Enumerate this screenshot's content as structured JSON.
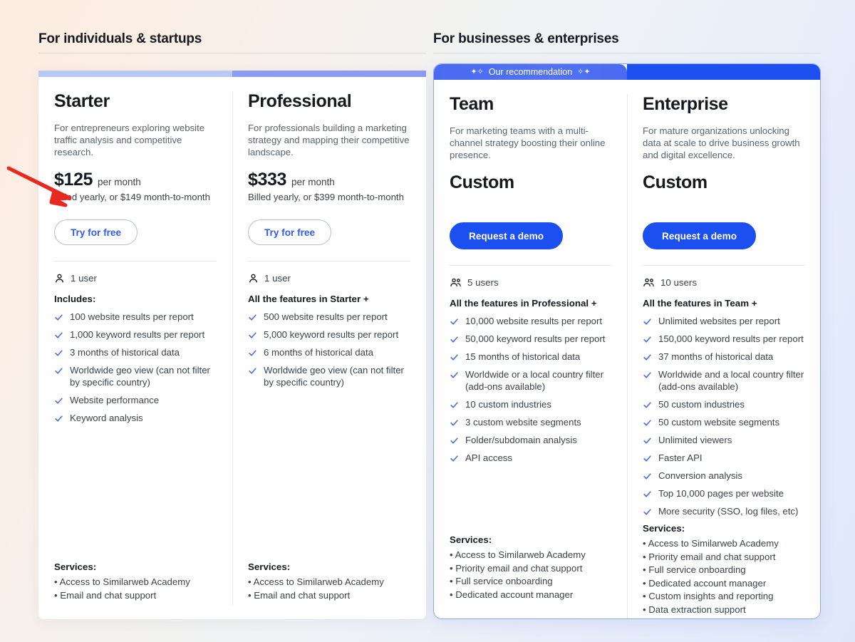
{
  "groups": [
    {
      "heading": "For individuals & startups",
      "recommended_ribbon": null,
      "plans": [
        {
          "name": "Starter",
          "description": "For entrepreneurs exploring website traffic analysis and competitive research.",
          "price": "$125",
          "price_unit": "per month",
          "billed_note": "Billed yearly, or $149 month-to-month",
          "cta_label": "Try for free",
          "cta_style": "outline",
          "users_icon": "single-user-icon",
          "users_label": "1 user",
          "features_title": "Includes:",
          "features": [
            "100 website results per report",
            "1,000 keyword results per report",
            "3 months of historical data",
            "Worldwide geo view (can not filter by specific country)",
            "Website performance",
            "Keyword analysis"
          ],
          "services_title": "Services:",
          "services": [
            "Access to Similarweb Academy",
            "Email and chat support"
          ],
          "strip_color": "#b9c9f6"
        },
        {
          "name": "Professional",
          "description": "For professionals building a marketing strategy and mapping their competitive landscape.",
          "price": "$333",
          "price_unit": "per month",
          "billed_note": "Billed yearly, or $399 month-to-month",
          "cta_label": "Try for free",
          "cta_style": "outline",
          "users_icon": "single-user-icon",
          "users_label": "1 user",
          "features_title": "All the features in Starter +",
          "features": [
            "500 website results per report",
            "5,000 keyword results per report",
            "6 months of historical data",
            "Worldwide geo view (can not filter by specific country)"
          ],
          "services_title": "Services:",
          "services": [
            "Access to Similarweb Academy",
            "Email and chat support"
          ],
          "strip_color": "#8c9cf2"
        }
      ]
    },
    {
      "heading": "For businesses & enterprises",
      "recommended_ribbon": "Our recommendation",
      "plans": [
        {
          "name": "Team",
          "description": "For marketing teams with a multi-channel strategy boosting their online presence.",
          "price": "Custom",
          "price_unit": "",
          "billed_note": "",
          "cta_label": "Request a demo",
          "cta_style": "solid",
          "users_icon": "multi-user-icon",
          "users_label": "5 users",
          "features_title": "All the features in Professional +",
          "features": [
            "10,000 website results per report",
            "50,000 keyword results per report",
            "15 months of historical data",
            "Worldwide or a local country filter (add-ons available)",
            "10 custom industries",
            "3 custom website segments",
            "Folder/subdomain analysis",
            "API access"
          ],
          "services_title": "Services:",
          "services": [
            "Access to Similarweb Academy",
            "Priority email and chat support",
            "Full service onboarding",
            "Dedicated account manager"
          ],
          "strip_color": "#4a6bf0"
        },
        {
          "name": "Enterprise",
          "description": "For mature organizations unlocking data at scale to drive business growth and digital excellence.",
          "price": "Custom",
          "price_unit": "",
          "billed_note": "",
          "cta_label": "Request a demo",
          "cta_style": "solid",
          "users_icon": "multi-user-icon",
          "users_label": "10 users",
          "features_title": "All the features in Team +",
          "features": [
            "Unlimited websites per report",
            "150,000 keyword results per report",
            "37 months of historical data",
            "Worldwide and a local country filter (add-ons available)",
            "50 custom industries",
            "50 custom website segments",
            "Unlimited viewers",
            "Faster API",
            "Conversion analysis",
            "Top 10,000 pages per website",
            "More security (SSO, log files, etc)"
          ],
          "services_title": "Services:",
          "services": [
            "Access to Similarweb Academy",
            "Priority email and chat support",
            "Full service onboarding",
            "Dedicated account manager",
            "Custom insights and reporting",
            "Data extraction support"
          ],
          "strip_color": "#1c4ff0"
        }
      ]
    }
  ],
  "annotation": {
    "arrow_color": "#e8291f",
    "points_at": "Try for free"
  },
  "colors": {
    "accent_blue": "#1c4ff0",
    "link_blue": "#2f5cf0",
    "check_blue": "#4a6bf0",
    "heading": "#16191f",
    "body_text": "#3c414b",
    "muted_text": "#5b6270"
  }
}
